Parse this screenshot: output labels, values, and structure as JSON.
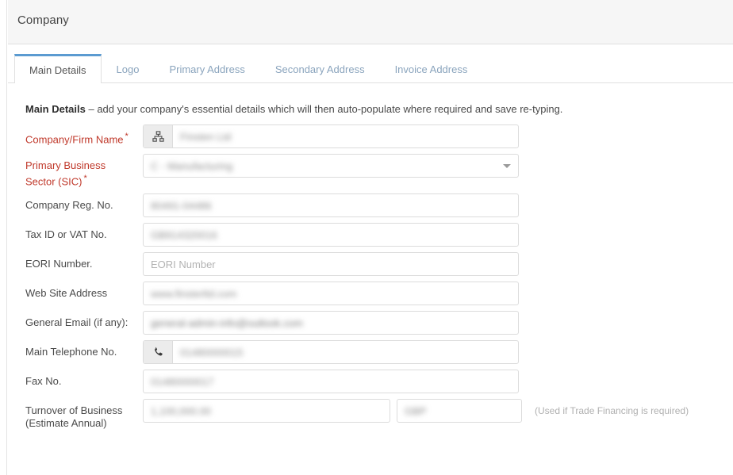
{
  "header": {
    "title": "Company"
  },
  "tabs": [
    {
      "label": "Main Details",
      "active": true
    },
    {
      "label": "Logo",
      "active": false
    },
    {
      "label": "Primary Address",
      "active": false
    },
    {
      "label": "Secondary Address",
      "active": false
    },
    {
      "label": "Invoice Address",
      "active": false
    }
  ],
  "intro": {
    "bold": "Main Details",
    "rest": " – add your company's essential details which will then auto-populate where required and save re-typing."
  },
  "form": {
    "company_name": {
      "label": "Company/Firm Name",
      "required": true,
      "required_marker": "*",
      "icon": "sitemap-icon",
      "value": "Finsten Ltd",
      "placeholder": ""
    },
    "sic": {
      "label_line1": "Primary Business",
      "label_line2": "Sector (SIC)",
      "required": true,
      "required_marker": "*",
      "value": "C - Manufacturing",
      "caret": "chevron-down-icon"
    },
    "company_reg": {
      "label": "Company Reg. No.",
      "required": false,
      "value": "80491-04486",
      "placeholder": ""
    },
    "tax_vat": {
      "label": "Tax ID or VAT No.",
      "required": false,
      "value": "GB914320016",
      "placeholder": ""
    },
    "eori": {
      "label": "EORI Number.",
      "required": false,
      "value": "",
      "placeholder": "EORI Number"
    },
    "website": {
      "label": "Web Site Address",
      "required": false,
      "value": "www.finsterltd.com",
      "placeholder": ""
    },
    "general_email": {
      "label": "General Email (if any):",
      "required": false,
      "value": "general-admin-info@outlook.com",
      "placeholder": ""
    },
    "telephone": {
      "label": "Main Telephone No.",
      "required": false,
      "icon": "phone-icon",
      "value": "01480000015",
      "placeholder": ""
    },
    "fax": {
      "label": "Fax No.",
      "required": false,
      "value": "01480000017",
      "placeholder": ""
    },
    "turnover": {
      "label_line1": "Turnover of Business",
      "label_line2": "(Estimate Annual)",
      "required": false,
      "amount_value": "1,100,000.00",
      "currency_value": "GBP",
      "hint": "(Used if Trade Financing is required)"
    }
  },
  "colors": {
    "accent": "#5b9bd1",
    "required": "#c0392b",
    "tab_inactive": "#8aa4bd",
    "header_bg": "#f6f6f6",
    "border": "#dcdcdc"
  }
}
